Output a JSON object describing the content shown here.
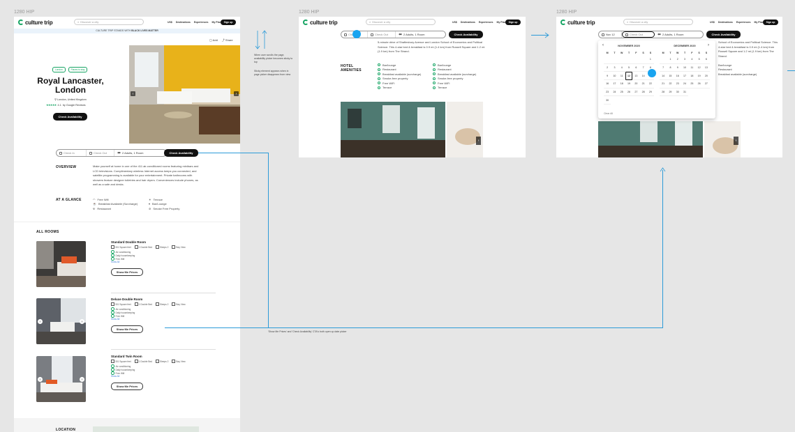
{
  "frames": {
    "label": "1280 HIP",
    "frame2_label": "1280 HIP",
    "frame3_label": "1280 HIP"
  },
  "header": {
    "logo": "culture trip",
    "search_placeholder": "Discover a city",
    "currency": "US$",
    "nav": [
      "Destinations",
      "Experiences",
      "My Places"
    ],
    "signup": "Sign up"
  },
  "banner": {
    "text_pre": "CULTURE TRIP STANDS WITH ",
    "text_bold": "BLACK LIVES MATTER"
  },
  "hotel": {
    "tags": [
      "London",
      "Places to stay"
    ],
    "name_line1": "Royal Lancaster,",
    "name_line2": "London",
    "location": "London, United Kingdom",
    "rating": "4.1",
    "rating_source": "by Google Reviews",
    "cta": "Check Availability",
    "actions": [
      "Add",
      "Share"
    ]
  },
  "picker": {
    "check_in": "Check In",
    "check_out": "Check Out",
    "guests": "2 Adults, 1 Room",
    "cta": "Check Availability",
    "selected_check_in": "Nov 12"
  },
  "overview": {
    "title": "OVERVIEW",
    "text": "Make yourself at home in one of the 411 air-conditioned rooms featuring minibars and LCD televisions. Complimentary wireless Internet access keeps you connected, and satellite programming is available for your entertainment. Private bathrooms with showers feature designer toiletries and hair dryers. Conveniences include phones, as well as a safe and desks."
  },
  "glance": {
    "title": "AT A GLANCE",
    "col1": [
      "Free Wifi",
      "Breakfast Available (Surcharge)",
      "Restaurant"
    ],
    "col2": [
      "Terrace",
      "Bar/Lounge",
      "Smoke Free Property"
    ]
  },
  "rooms": {
    "title": "ALL ROOMS",
    "items": [
      {
        "name": "Standard Double Room",
        "specs": [
          "301 Square feet",
          "1 Double Bed",
          "Sleeps 2",
          "Bay View"
        ],
        "features": [
          "Air conditioning",
          "Daily housekeeping",
          "Free Wifi"
        ],
        "more": "Show All",
        "cta": "Show Me Prices"
      },
      {
        "name": "Deluxe Double Room",
        "specs": [
          "301 Square feet",
          "1 Double Bed",
          "Sleeps 2",
          "Bay View"
        ],
        "features": [
          "Air conditioning",
          "Daily housekeeping",
          "Free Wifi"
        ],
        "more": "Show All",
        "cta": "Show Me Prices"
      },
      {
        "name": "Standard Twin Room",
        "specs": [
          "301 Square feet",
          "1 Double Bed",
          "Sleeps 2",
          "Bay View"
        ],
        "features": [
          "Air conditioning",
          "Daily housekeeping",
          "Free Wifi"
        ],
        "more": "Show All",
        "cta": "Show Me Prices"
      }
    ]
  },
  "location_title": "LOCATION",
  "notes": {
    "sticky": "When user scrolls the page, availability picker becomes sticky to top",
    "sticky2": "Sticky element appears when in page picker disappears from view",
    "cta_note": "'Show Me Prices' and 'Check Availability' CTA's both open up date picker"
  },
  "frame2": {
    "intro": "5-minute drive of Shaftesbury Avenue and London School of Economics and Political Science. This 4-star bed & breakfast is 0.9 mi (1.4 km) from Russell Square and 1.2 mi (1.9 km) from The Strand.",
    "amenities_title_1": "HOTEL",
    "amenities_title_2": "AMENITIES",
    "col1": [
      "Bar/lounge",
      "Restaurant",
      "Breakfast available (surcharge)",
      "Smoke-free property",
      "Free WiFi",
      "Terrace"
    ],
    "col2": [
      "Bar/lounge",
      "Restaurant",
      "Breakfast available (surcharge)",
      "Smoke-free property",
      "Free WiFi",
      "Terrace"
    ]
  },
  "frame3": {
    "intro": "School of Economics and Political Science. This 4-star bed & breakfast is 0.9 mi (1.4 km) from Russell Square and 1.2 mi (1.9 km) from The Strand.",
    "amen_col1": [
      "Bar/lounge",
      "Restaurant",
      "Breakfast available (surcharge)"
    ],
    "amen_col2": [
      "Bar/lounge",
      "Restaurant",
      "Breakfast available (surcharge)"
    ],
    "calendar": {
      "month1": "NOVEMBER 2020",
      "month2": "DECEMBER 2020",
      "dow": [
        "M",
        "T",
        "W",
        "T",
        "F",
        "S",
        "S"
      ],
      "nov": [
        "",
        "",
        "",
        "",
        "",
        "",
        "1",
        "2",
        "3",
        "4",
        "5",
        "6",
        "7",
        "8",
        "9",
        "10",
        "11",
        "12",
        "13",
        "14",
        "15",
        "16",
        "17",
        "18",
        "19",
        "20",
        "21",
        "22",
        "23",
        "24",
        "25",
        "26",
        "27",
        "28",
        "29",
        "30"
      ],
      "dec": [
        "",
        "1",
        "2",
        "3",
        "4",
        "5",
        "6",
        "7",
        "8",
        "9",
        "10",
        "11",
        "12",
        "13",
        "14",
        "15",
        "16",
        "17",
        "18",
        "19",
        "20",
        "21",
        "22",
        "23",
        "24",
        "25",
        "26",
        "27",
        "28",
        "29",
        "30",
        "31"
      ],
      "selected": "12",
      "clear": "Clear All"
    }
  },
  "colors": {
    "brand_green": "#17a564",
    "accent_blue": "#19a4f0",
    "connector": "#2b9ad8"
  }
}
